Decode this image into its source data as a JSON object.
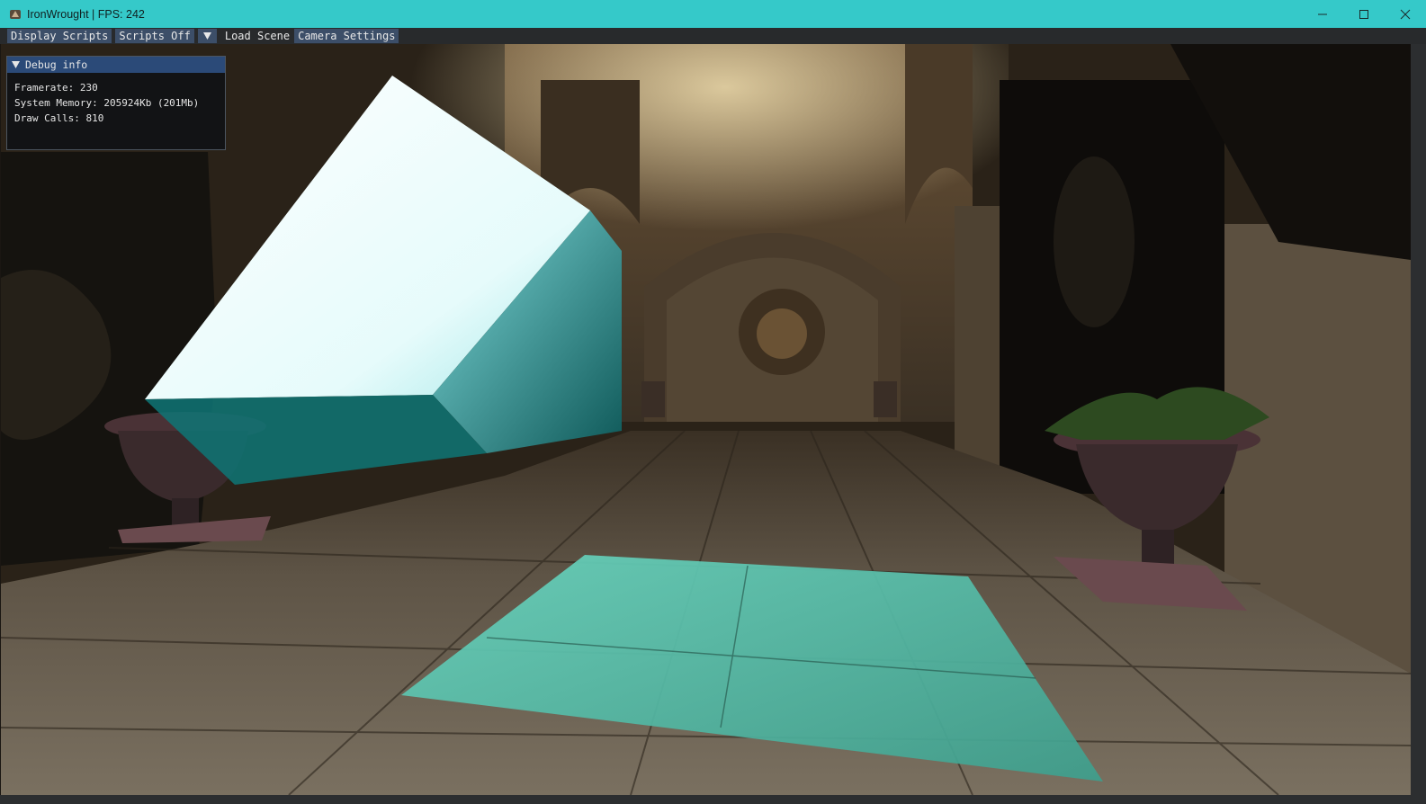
{
  "window": {
    "title": "IronWrought | FPS: 242",
    "accent_color": "#35c9c9",
    "icons": [
      "app-icon",
      "minimize-icon",
      "maximize-icon",
      "close-icon"
    ]
  },
  "menubar": {
    "display_scripts": "Display Scripts",
    "scripts_off": "Scripts Off",
    "load_scene": "Load Scene",
    "camera_settings": "Camera Settings"
  },
  "debug": {
    "title": "Debug info",
    "framerate": "Framerate: 230",
    "memory": "System Memory: 205924Kb (201Mb)",
    "draw_calls": "Draw Calls: 810"
  }
}
